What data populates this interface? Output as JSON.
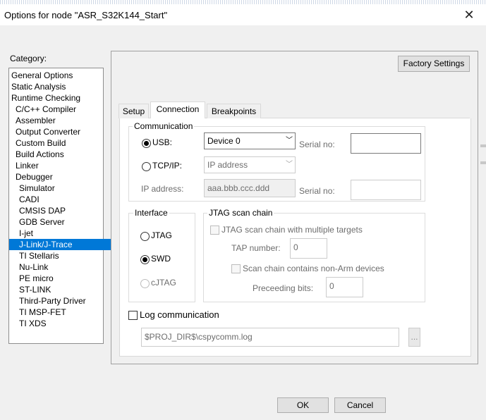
{
  "window": {
    "title": "Options for node \"ASR_S32K144_Start\""
  },
  "category": {
    "label": "Category:",
    "items": [
      {
        "label": "General Options",
        "level": 0
      },
      {
        "label": "Static Analysis",
        "level": 0
      },
      {
        "label": "Runtime Checking",
        "level": 0
      },
      {
        "label": "C/C++ Compiler",
        "level": 1
      },
      {
        "label": "Assembler",
        "level": 1
      },
      {
        "label": "Output Converter",
        "level": 1
      },
      {
        "label": "Custom Build",
        "level": 1
      },
      {
        "label": "Build Actions",
        "level": 1
      },
      {
        "label": "Linker",
        "level": 1
      },
      {
        "label": "Debugger",
        "level": 1
      },
      {
        "label": "Simulator",
        "level": 2
      },
      {
        "label": "CADI",
        "level": 2
      },
      {
        "label": "CMSIS DAP",
        "level": 2
      },
      {
        "label": "GDB Server",
        "level": 2
      },
      {
        "label": "I-jet",
        "level": 2
      },
      {
        "label": "J-Link/J-Trace",
        "level": 2,
        "selected": true
      },
      {
        "label": "TI Stellaris",
        "level": 2
      },
      {
        "label": "Nu-Link",
        "level": 2
      },
      {
        "label": "PE micro",
        "level": 2
      },
      {
        "label": "ST-LINK",
        "level": 2
      },
      {
        "label": "Third-Party Driver",
        "level": 2
      },
      {
        "label": "TI MSP-FET",
        "level": 2
      },
      {
        "label": "TI XDS",
        "level": 2
      }
    ]
  },
  "factory_settings_label": "Factory Settings",
  "tabs": [
    {
      "label": "Setup",
      "active": false
    },
    {
      "label": "Connection",
      "active": true
    },
    {
      "label": "Breakpoints",
      "active": false
    }
  ],
  "communication": {
    "title": "Communication",
    "usb": {
      "label": "USB:",
      "selected": true,
      "device_value": "Device 0"
    },
    "serial_label": "Serial no:",
    "tcpip": {
      "label": "TCP/IP:",
      "selected": false,
      "mode_value": "IP address"
    },
    "ip_label": "IP address:",
    "ip_placeholder": "aaa.bbb.ccc.ddd",
    "serial_label_2": "Serial no:"
  },
  "interface": {
    "title": "Interface",
    "options": [
      {
        "label": "JTAG",
        "selected": false,
        "enabled": true
      },
      {
        "label": "SWD",
        "selected": true,
        "enabled": true
      },
      {
        "label": "cJTAG",
        "selected": false,
        "enabled": false
      }
    ]
  },
  "jtag_chain": {
    "title": "JTAG scan chain",
    "multi_targets_label": "JTAG scan chain with multiple targets",
    "tap_label": "TAP number:",
    "tap_value": "0",
    "non_arm_label": "Scan chain contains non-Arm devices",
    "preceding_label": "Preceeding bits:",
    "preceding_value": "0"
  },
  "log": {
    "label": "Log communication",
    "checked": false,
    "path": "$PROJ_DIR$\\cspycomm.log",
    "browse_label": "..."
  },
  "buttons": {
    "ok": "OK",
    "cancel": "Cancel"
  }
}
